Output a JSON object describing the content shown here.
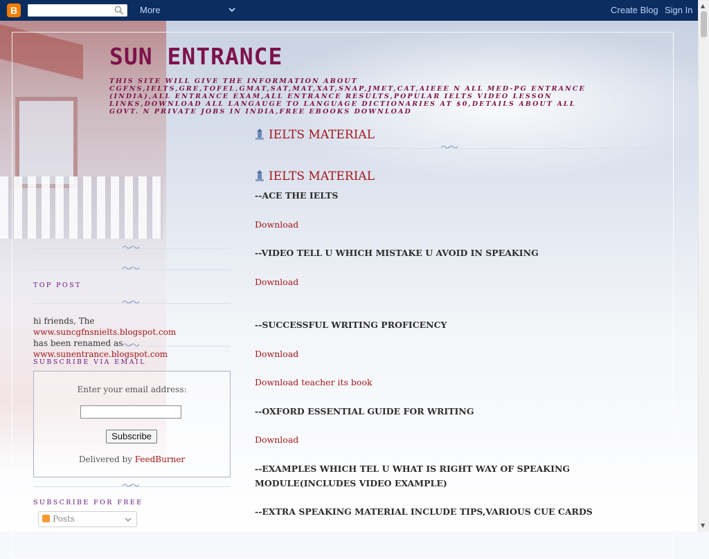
{
  "navbar": {
    "logo_letter": "B",
    "search_placeholder": "",
    "more_label": "More",
    "create_blog_label": "Create Blog",
    "sign_in_label": "Sign In"
  },
  "header": {
    "title": "SUN ENTRANCE",
    "description": "THIS SITE WILL GIVE THE INFORMATION ABOUT CGFNS,IELTS,GRE,TOFEL,GMAT,SAT,MAT,XAT,SNAP,JMET,CAT,AIEEE N ALL MED-PG ENTRANCE (INDIA),ALL ENTRANCE EXAM,ALL ENTRANCE RESULTS,POPULAR IELTS VIDEO LESSON LINKS,DOWNLOAD ALL LANGAUGE TO LANGUAGE DICTIONARIES AT $0,DETAILS ABOUT ALL GOVT. N PRIVATE JOBS IN INDIA,FREE EBOOKS DOWNLOAD"
  },
  "post": {
    "page_heading": "IELTS MATERIAL",
    "title": "IELTS MATERIAL",
    "items": [
      "--ACE THE IELTS",
      "Download",
      "--VIDEO TELL U WHICH MISTAKE U AVOID IN SPEAKING",
      "Download",
      "--SUCCESSFUL WRITING PROFICENCY",
      "Download",
      "Download teacher its book",
      "--OXFORD ESSENTIAL GUIDE FOR WRITING",
      "Download",
      "--EXAMPLES WHICH TEL U WHAT IS RIGHT WAY OF SPEAKING MODULE(INCLUDES VIDEO EXAMPLE)",
      "--EXTRA SPEAKING MATERIAL INCLUDE TIPS,VARIOUS CUE CARDS"
    ]
  },
  "sidebar": {
    "top_post_heading": "TOP POST",
    "notice_prefix": "hi friends, The",
    "old_url": "www.suncgfnsnielts.blogspot.com",
    "notice_middle": "has been renamed as",
    "new_url": "www.sunentrance.blogspot.com",
    "subscribe_email_heading": "SUBSCRIBE VIA EMAIL",
    "email_prompt": "Enter your email address:",
    "subscribe_button": "Subscribe",
    "delivered_by": "Delivered by",
    "feedburner": "FeedBurner",
    "subscribe_free_heading": "SUBSCRIBE FOR FREE",
    "posts_dropdown": "Posts"
  },
  "colors": {
    "navbar_bg": "#0b2d5f",
    "title": "#7d1249",
    "link": "#a4161a",
    "sidebar_heading": "#6b1480"
  }
}
